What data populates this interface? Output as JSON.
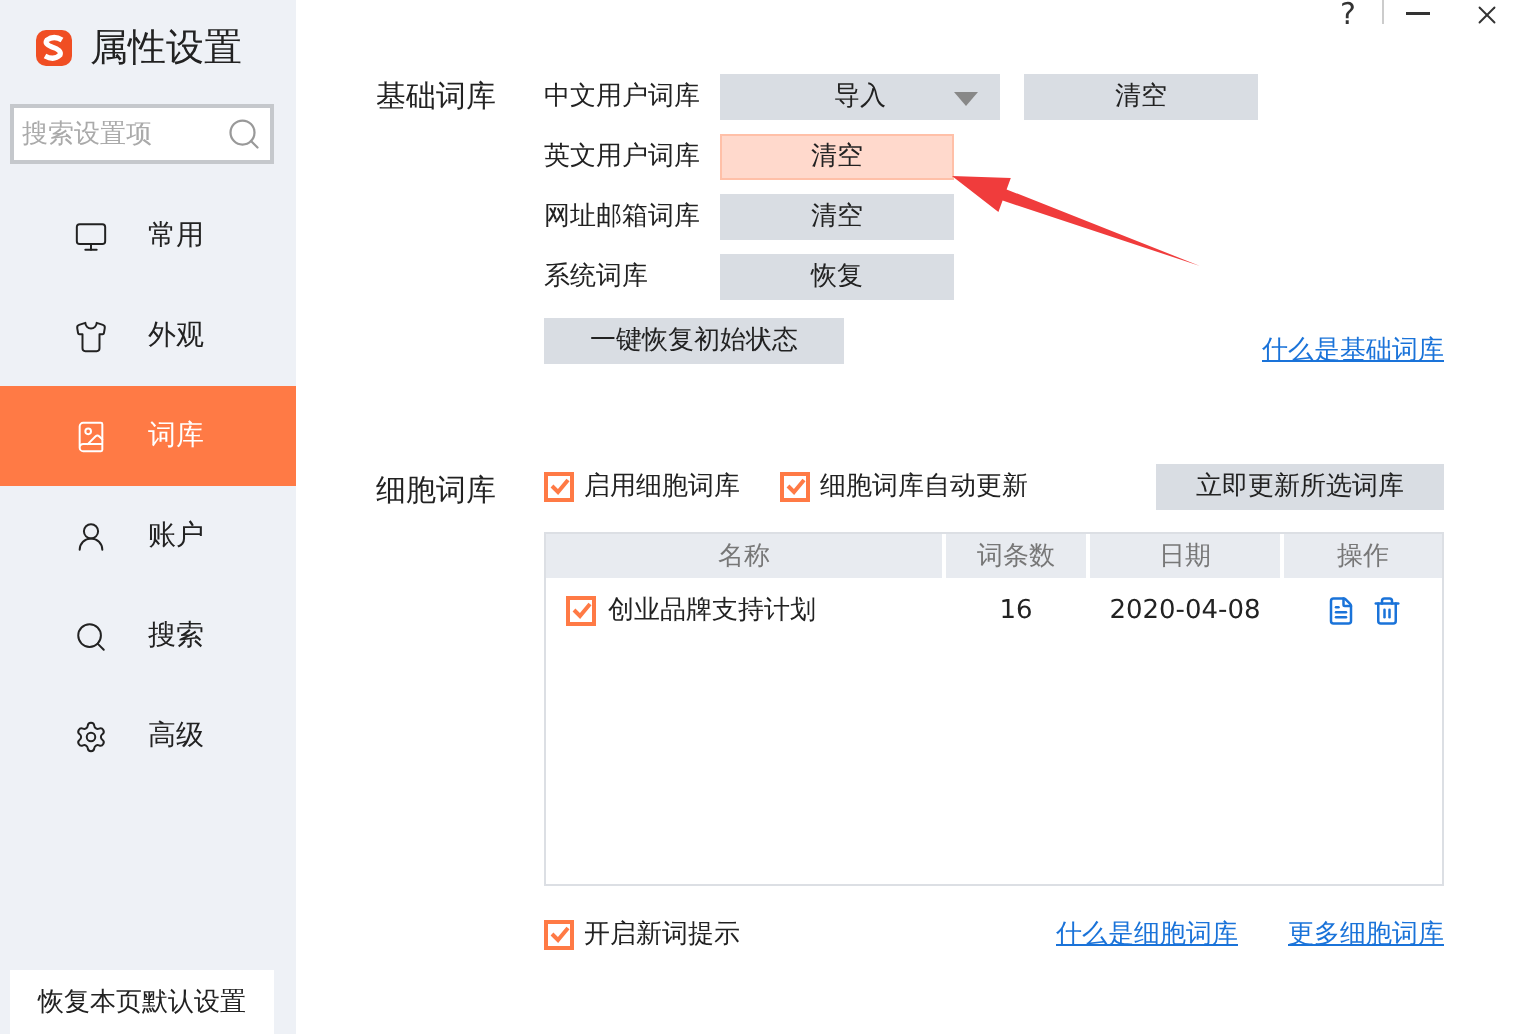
{
  "app": {
    "title": "属性设置"
  },
  "window_controls": [
    {
      "kind": "help",
      "label": "?"
    },
    {
      "kind": "minimize"
    },
    {
      "kind": "close"
    }
  ],
  "sidebar": {
    "search": {
      "placeholder": "搜索设置项"
    },
    "items": [
      {
        "label": "常用",
        "selected": false
      },
      {
        "label": "外观",
        "selected": false
      },
      {
        "label": "词库",
        "selected": true
      },
      {
        "label": "账户",
        "selected": false
      },
      {
        "label": "搜索",
        "selected": false
      },
      {
        "label": "高级",
        "selected": false
      }
    ],
    "reset_button": "恢复本页默认设置"
  },
  "basic_dict": {
    "title": "基础词库",
    "rows": [
      {
        "label": "中文用户词库",
        "buttons": [
          {
            "kind": "dropdown",
            "label": "导入",
            "highlighted": false
          },
          {
            "kind": "button",
            "label": "清空",
            "highlighted": false
          }
        ]
      },
      {
        "label": "英文用户词库",
        "buttons": [
          {
            "kind": "button",
            "label": "清空",
            "highlighted": true
          }
        ]
      },
      {
        "label": "网址邮箱词库",
        "buttons": [
          {
            "kind": "button",
            "label": "清空",
            "highlighted": false
          }
        ]
      },
      {
        "label": "系统词库",
        "buttons": [
          {
            "kind": "button",
            "label": "恢复",
            "highlighted": false
          }
        ]
      }
    ],
    "reset_all": "一键恢复初始状态",
    "help_link": "什么是基础词库"
  },
  "cell_dict": {
    "title": "细胞词库",
    "options": [
      {
        "label": "启用细胞词库",
        "checked": true
      },
      {
        "label": "细胞词库自动更新",
        "checked": true
      }
    ],
    "update_button": "立即更新所选词库",
    "table": {
      "columns": [
        "名称",
        "词条数",
        "日期",
        "操作"
      ],
      "rows": [
        {
          "name": "创业品牌支持计划",
          "checked": true,
          "count": "16",
          "date": "2020-04-08"
        }
      ]
    },
    "new_word_tip": {
      "label": "开启新词提示",
      "checked": true
    },
    "links": [
      "什么是细胞词库",
      "更多细胞词库"
    ]
  }
}
